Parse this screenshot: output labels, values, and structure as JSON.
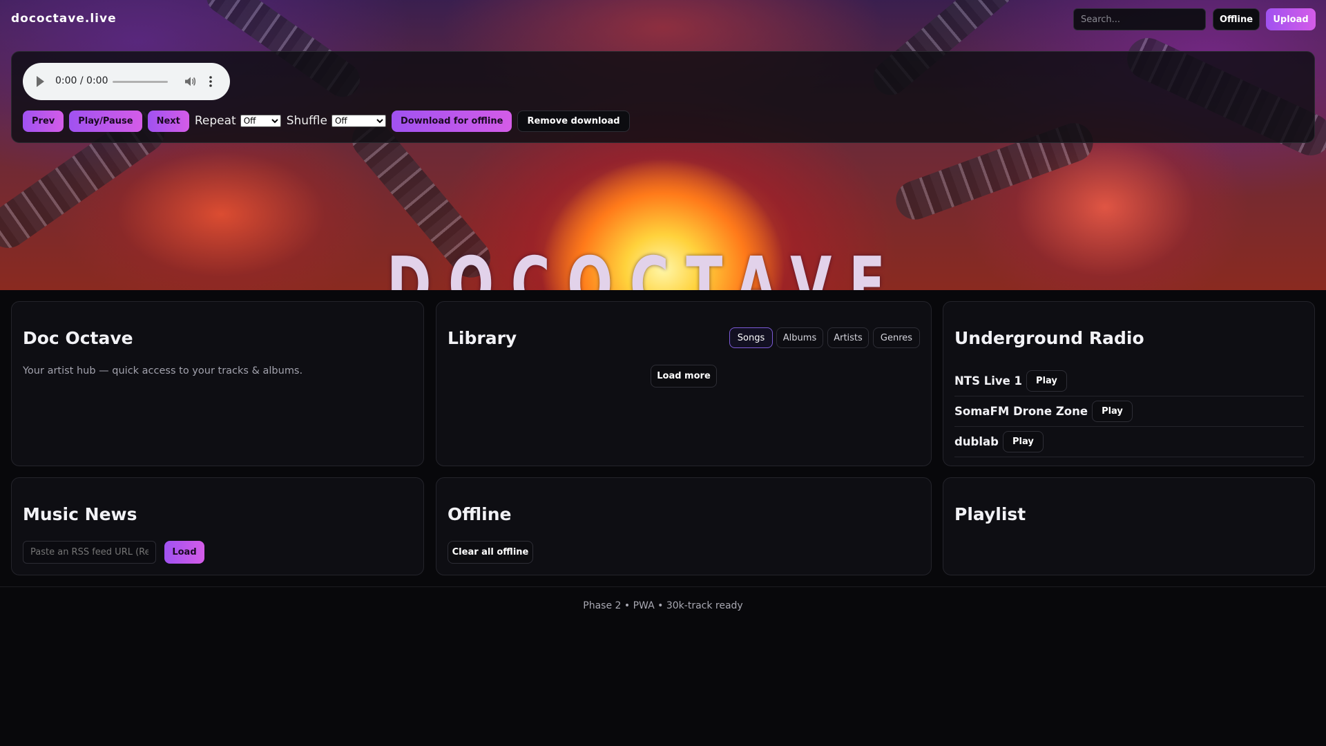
{
  "header": {
    "brand": "dococtave.live",
    "search_placeholder": "Search...",
    "offline_label": "Offline",
    "upload_label": "Upload"
  },
  "hero": {
    "title": "DOCOCTAVE"
  },
  "player": {
    "time": "0:00 / 0:00",
    "prev_label": "Prev",
    "playpause_label": "Play/Pause",
    "next_label": "Next",
    "repeat_label": "Repeat",
    "repeat_value": "Off",
    "shuffle_label": "Shuffle",
    "shuffle_value": "Off",
    "download_label": "Download for offline",
    "remove_label": "Remove download"
  },
  "artist": {
    "title": "Doc Octave",
    "description": "Your artist hub — quick access to your tracks & albums."
  },
  "library": {
    "title": "Library",
    "tabs": [
      "Songs",
      "Albums",
      "Artists",
      "Genres"
    ],
    "active_tab": "Songs",
    "load_more_label": "Load more"
  },
  "radio": {
    "title": "Underground Radio",
    "stations": [
      {
        "name": "NTS Live 1",
        "action": "Play"
      },
      {
        "name": "SomaFM Drone Zone",
        "action": "Play"
      },
      {
        "name": "dublab",
        "action": "Play"
      }
    ]
  },
  "news": {
    "title": "Music News",
    "input_placeholder": "Paste an RSS feed URL (Re",
    "load_label": "Load"
  },
  "offline": {
    "title": "Offline",
    "clear_label": "Clear all offline"
  },
  "playlist": {
    "title": "Playlist"
  },
  "footer": {
    "text": "Phase 2 • PWA • 30k-track ready"
  },
  "colors": {
    "accent_start": "#a052f0",
    "accent_end": "#d45ce8",
    "background": "#08080b",
    "card": "#0e0e13"
  }
}
